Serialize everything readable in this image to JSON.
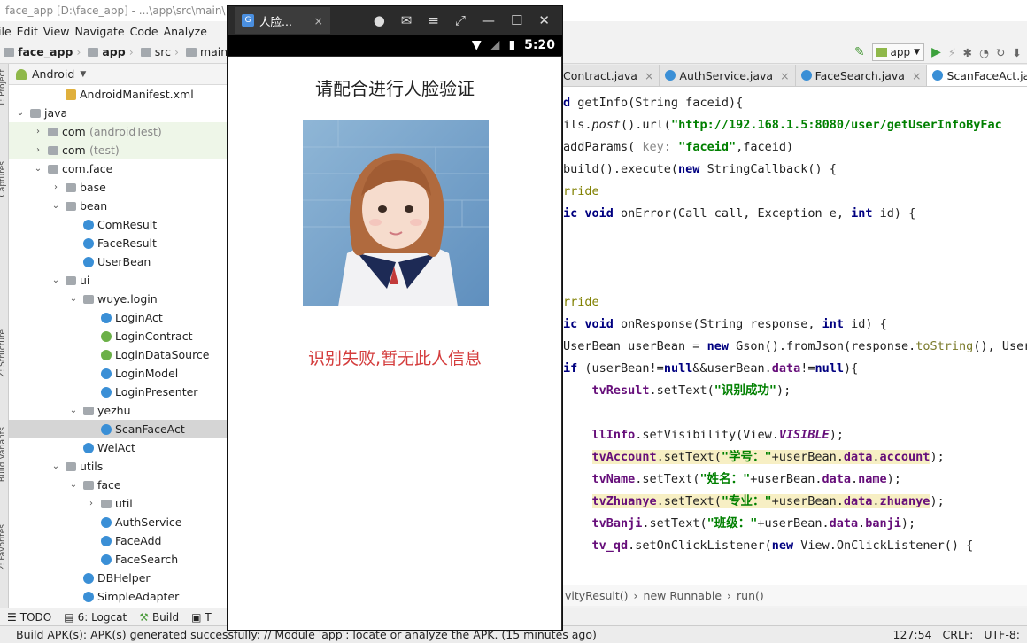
{
  "window": {
    "title": "face_app [D:\\face_app] - ...\\app\\src\\main\\"
  },
  "menu": [
    "ile",
    "Edit",
    "View",
    "Navigate",
    "Code",
    "Analyze"
  ],
  "nav": {
    "project": "face_app",
    "module": "app",
    "src": "src",
    "main": "main",
    "run_config": "app"
  },
  "project_panel": {
    "view": "Android",
    "tree": [
      {
        "label": "AndroidManifest.xml",
        "indent": 3,
        "icon": "xml",
        "arrow": ""
      },
      {
        "label": "java",
        "indent": 1,
        "icon": "folder",
        "arrow": "v"
      },
      {
        "label": "com",
        "suffix": "(androidTest)",
        "indent": 2,
        "icon": "folder",
        "arrow": ">",
        "green": true
      },
      {
        "label": "com",
        "suffix": "(test)",
        "indent": 2,
        "icon": "folder",
        "arrow": ">",
        "green": true
      },
      {
        "label": "com.face",
        "indent": 2,
        "icon": "folder",
        "arrow": "v"
      },
      {
        "label": "base",
        "indent": 3,
        "icon": "folder",
        "arrow": ">"
      },
      {
        "label": "bean",
        "indent": 3,
        "icon": "folder",
        "arrow": "v"
      },
      {
        "label": "ComResult",
        "indent": 4,
        "icon": "cls",
        "arrow": ""
      },
      {
        "label": "FaceResult",
        "indent": 4,
        "icon": "cls",
        "arrow": ""
      },
      {
        "label": "UserBean",
        "indent": 4,
        "icon": "cls",
        "arrow": ""
      },
      {
        "label": "ui",
        "indent": 3,
        "icon": "folder",
        "arrow": "v"
      },
      {
        "label": "wuye.login",
        "indent": 4,
        "icon": "folder",
        "arrow": "v"
      },
      {
        "label": "LoginAct",
        "indent": 5,
        "icon": "cls",
        "arrow": ""
      },
      {
        "label": "LoginContract",
        "indent": 5,
        "icon": "intf",
        "arrow": ""
      },
      {
        "label": "LoginDataSource",
        "indent": 5,
        "icon": "intf",
        "arrow": ""
      },
      {
        "label": "LoginModel",
        "indent": 5,
        "icon": "cls",
        "arrow": ""
      },
      {
        "label": "LoginPresenter",
        "indent": 5,
        "icon": "cls",
        "arrow": ""
      },
      {
        "label": "yezhu",
        "indent": 4,
        "icon": "folder",
        "arrow": "v"
      },
      {
        "label": "ScanFaceAct",
        "indent": 5,
        "icon": "cls",
        "arrow": "",
        "selected": true
      },
      {
        "label": "WelAct",
        "indent": 4,
        "icon": "cls",
        "arrow": ""
      },
      {
        "label": "utils",
        "indent": 3,
        "icon": "folder",
        "arrow": "v"
      },
      {
        "label": "face",
        "indent": 4,
        "icon": "folder",
        "arrow": "v"
      },
      {
        "label": "util",
        "indent": 5,
        "icon": "folder",
        "arrow": ">"
      },
      {
        "label": "AuthService",
        "indent": 5,
        "icon": "cls",
        "arrow": ""
      },
      {
        "label": "FaceAdd",
        "indent": 5,
        "icon": "cls",
        "arrow": ""
      },
      {
        "label": "FaceSearch",
        "indent": 5,
        "icon": "cls",
        "arrow": ""
      },
      {
        "label": "DBHelper",
        "indent": 4,
        "icon": "cls",
        "arrow": ""
      },
      {
        "label": "SimpleAdapter",
        "indent": 4,
        "icon": "cls",
        "arrow": ""
      }
    ]
  },
  "side_tools": [
    "1: Project",
    "Captures",
    "Z: Structure",
    "Build Variants",
    "2: Favorites"
  ],
  "editor_tabs": [
    {
      "label": "Contract.java",
      "active": false
    },
    {
      "label": "AuthService.java",
      "active": false
    },
    {
      "label": "FaceSearch.java",
      "active": false
    },
    {
      "label": "ScanFaceAct.java",
      "active": true
    }
  ],
  "editor_crumbs": [
    "vityResult()",
    "new Runnable",
    "run()"
  ],
  "bottom_tools": [
    "TODO",
    "6: Logcat",
    "Build",
    "T"
  ],
  "status": {
    "message": "Build APK(s): APK(s) generated successfully: // Module 'app': locate or analyze the APK. (15 minutes ago)",
    "position": "127:54",
    "line_sep": "CRLF:",
    "encoding": "UTF-8:"
  },
  "emulator": {
    "tab_title": "人脸...",
    "time": "5:20",
    "screen_title": "请配合进行人脸验证",
    "result_text": "识别失败,暂无此人信息"
  },
  "colors": {
    "result": "#d43c3c",
    "selected_row": "#d5d5d5",
    "class_icon": "#3a8fd6"
  }
}
